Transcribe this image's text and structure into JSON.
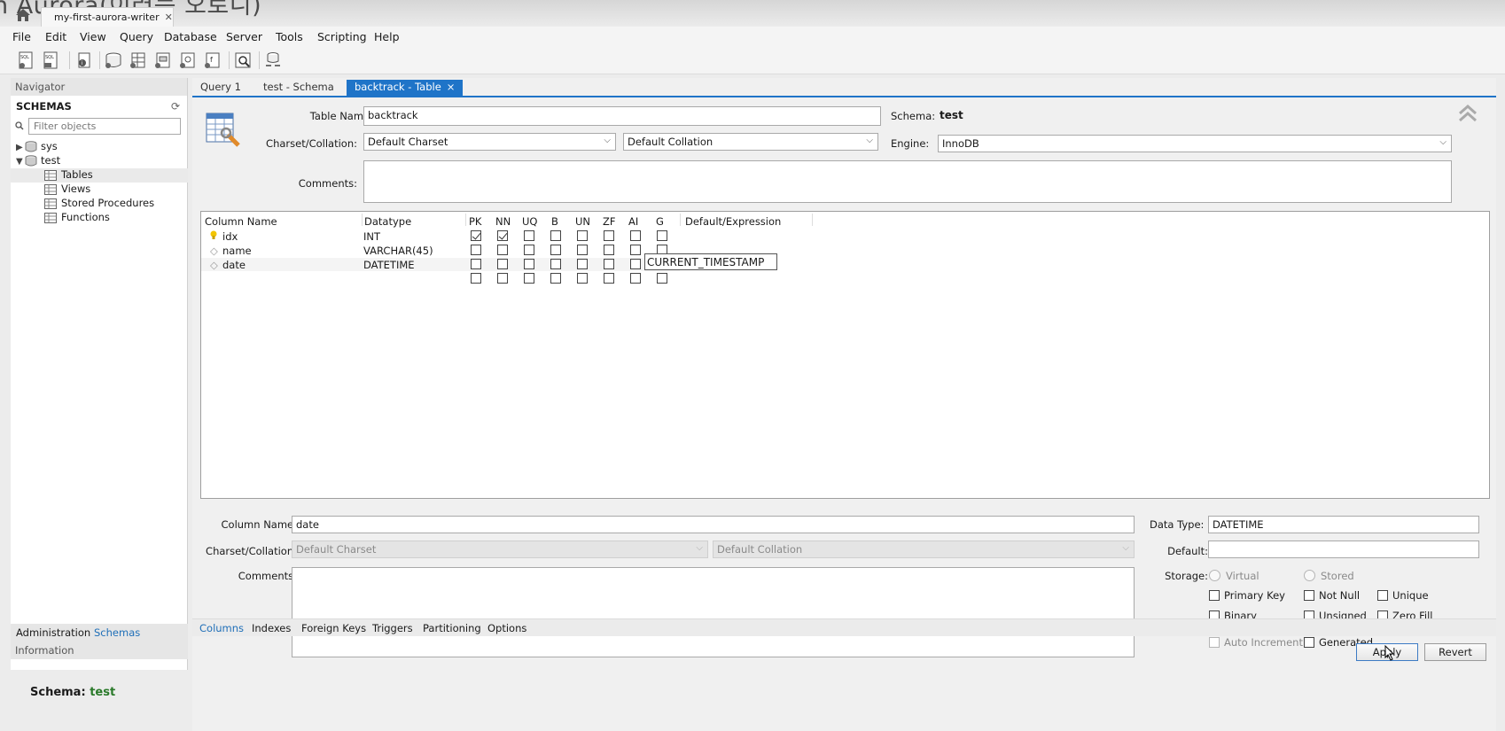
{
  "window": {
    "title_overlay": "n Aurora(이러는 오로니)",
    "connection_tab": "my-first-aurora-writer",
    "connection_close": "✕"
  },
  "menu": [
    "File",
    "Edit",
    "View",
    "Query",
    "Database",
    "Server",
    "Tools",
    "Scripting",
    "Help"
  ],
  "navigator": {
    "header": "Navigator",
    "schemas_label": "SCHEMAS",
    "filter_placeholder": "Filter objects",
    "tree": {
      "sys": "sys",
      "test": "test",
      "tables": "Tables",
      "views": "Views",
      "procedures": "Stored Procedures",
      "functions": "Functions"
    },
    "tab_admin": "Administration",
    "tab_schemas": "Schemas",
    "info_header": "Information",
    "schema_info_label": "Schema:",
    "schema_info_value": "test"
  },
  "doc_tabs": {
    "query": "Query 1",
    "schema": "test - Schema",
    "table": "backtrack - Table",
    "close": "×"
  },
  "table_editor": {
    "table_name_label": "Table Name:",
    "table_name": "backtrack",
    "schema_label": "Schema:",
    "schema_value": "test",
    "charset_label": "Charset/Collation:",
    "charset": "Default Charset",
    "collation": "Default Collation",
    "engine_label": "Engine:",
    "engine": "InnoDB",
    "comments_label": "Comments:"
  },
  "grid": {
    "headers": {
      "name": "Column Name",
      "type": "Datatype",
      "pk": "PK",
      "nn": "NN",
      "uq": "UQ",
      "b": "B",
      "un": "UN",
      "zf": "ZF",
      "ai": "AI",
      "g": "G",
      "def": "Default/Expression"
    },
    "rows": [
      {
        "name": "idx",
        "type": "INT",
        "flags": [
          true,
          true,
          false,
          false,
          false,
          false,
          false,
          false
        ]
      },
      {
        "name": "name",
        "type": "VARCHAR(45)",
        "flags": [
          false,
          false,
          false,
          false,
          false,
          false,
          false,
          false
        ]
      },
      {
        "name": "date",
        "type": "DATETIME",
        "flags": [
          false,
          false,
          false,
          false,
          false,
          false,
          false,
          false
        ]
      },
      {
        "name": "",
        "type": "",
        "flags": [
          false,
          false,
          false,
          false,
          false,
          false,
          false,
          false
        ]
      }
    ],
    "editing_value": "CURRENT_TIMESTAMP"
  },
  "column_details": {
    "name_label": "Column Name:",
    "name": "date",
    "charset_label": "Charset/Collation:",
    "charset": "Default Charset",
    "collation": "Default Collation",
    "comments_label": "Comments:",
    "datatype_label": "Data Type:",
    "datatype": "DATETIME",
    "default_label": "Default:",
    "default": "",
    "storage_label": "Storage:",
    "virtual": "Virtual",
    "stored": "Stored",
    "primary_key": "Primary Key",
    "not_null": "Not Null",
    "unique": "Unique",
    "binary": "Binary",
    "unsigned": "Unsigned",
    "zero_fill": "Zero Fill",
    "auto_increment": "Auto Increment",
    "generated": "Generated"
  },
  "sub_tabs": [
    "Columns",
    "Indexes",
    "Foreign Keys",
    "Triggers",
    "Partitioning",
    "Options"
  ],
  "buttons": {
    "apply": "Apply",
    "revert": "Revert"
  },
  "colors": {
    "accent": "#1f74c8",
    "schema_value": "#2a7a2a"
  }
}
